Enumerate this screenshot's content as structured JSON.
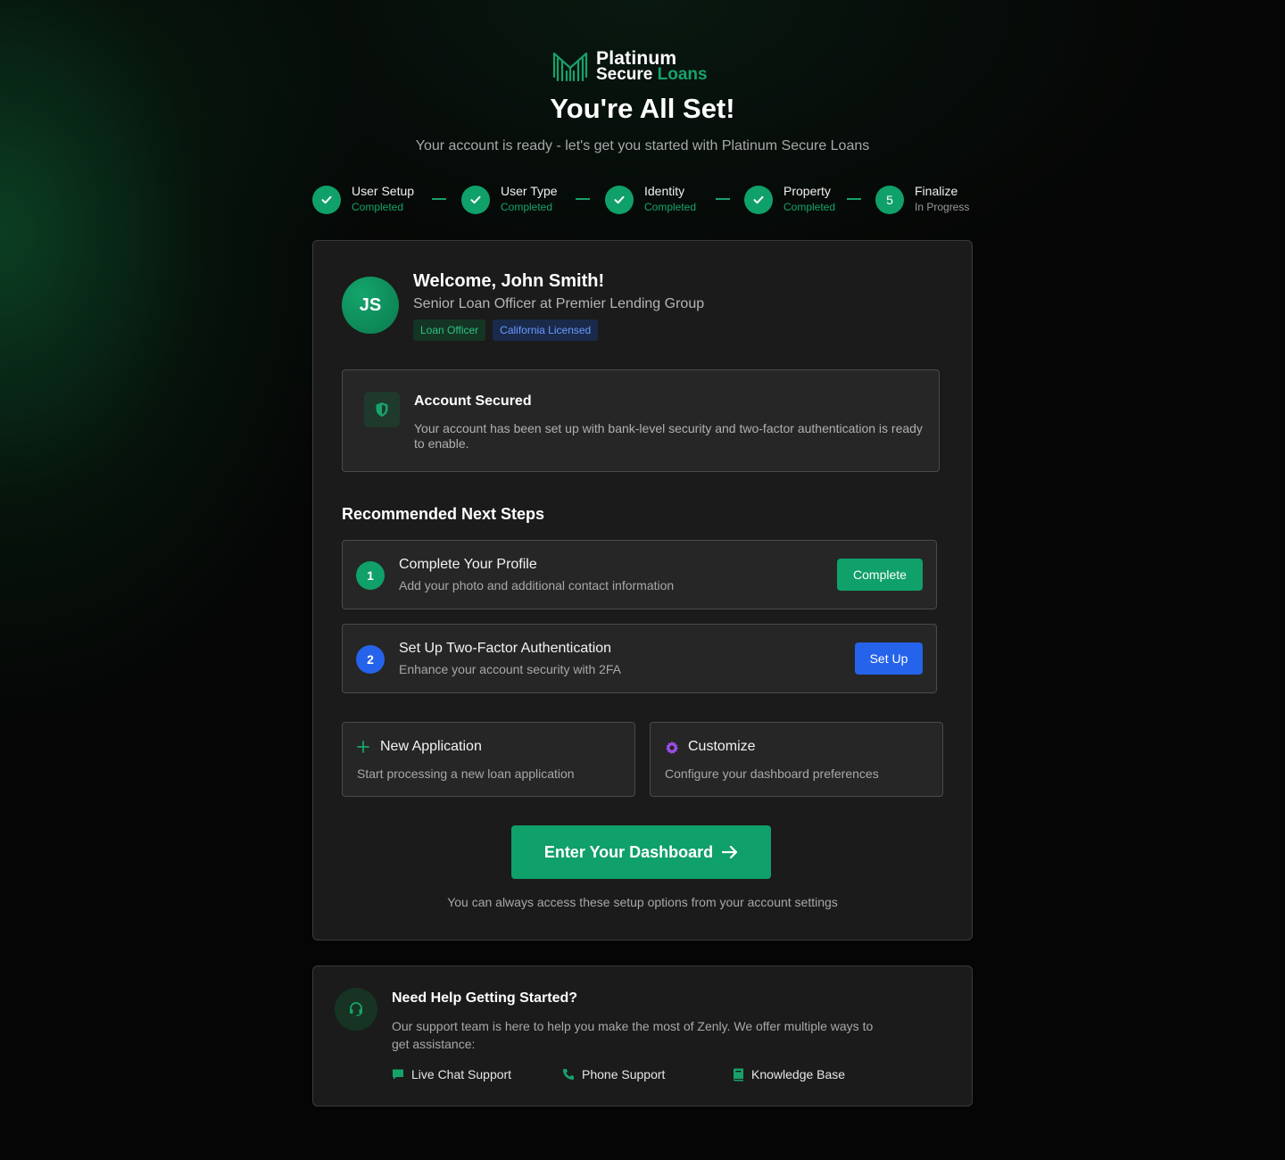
{
  "brand": {
    "line1": "Platinum",
    "line2a": "Secure",
    "line2b": "Loans",
    "accent_color": "#16a36a"
  },
  "header": {
    "title": "You're All Set!",
    "subtitle": "Your account is ready - let's get you started with Platinum Secure Loans"
  },
  "steps": [
    {
      "name": "User Setup",
      "status": "Completed",
      "icon": "check-icon"
    },
    {
      "name": "User Type",
      "status": "Completed",
      "icon": "check-icon"
    },
    {
      "name": "Identity",
      "status": "Completed",
      "icon": "check-icon"
    },
    {
      "name": "Property",
      "status": "Completed",
      "icon": "check-icon"
    },
    {
      "name": "Finalize",
      "status": "In Progress",
      "number": "5"
    }
  ],
  "profile": {
    "initials": "JS",
    "welcome": "Welcome, John Smith!",
    "role": "Senior Loan Officer at Premier Lending Group",
    "badges": [
      "Loan Officer",
      "California Licensed"
    ]
  },
  "security": {
    "icon": "shield-icon",
    "title": "Account Secured",
    "description": "Your account has been set up with bank-level security and two-factor authentication is ready to enable."
  },
  "next_steps": {
    "title": "Recommended Next Steps",
    "items": [
      {
        "number": "1",
        "title": "Complete Your Profile",
        "description": "Add your photo and additional contact information",
        "button": "Complete",
        "color": "#10a06a"
      },
      {
        "number": "2",
        "title": "Set Up Two-Factor Authentication",
        "description": "Enhance your account security with 2FA",
        "button": "Set Up",
        "color": "#2563eb"
      }
    ]
  },
  "quick_actions": [
    {
      "icon": "plus-icon",
      "title": "New Application",
      "description": "Start processing a new loan application"
    },
    {
      "icon": "gear-icon",
      "title": "Customize",
      "description": "Configure your dashboard preferences"
    }
  ],
  "cta": {
    "label": "Enter Your Dashboard",
    "icon": "arrow-right-icon",
    "footnote": "You can always access these setup options from your account settings"
  },
  "help": {
    "icon": "headset-icon",
    "title": "Need Help Getting Started?",
    "description": "Our support team is here to help you make the most of Zenly. We offer multiple ways to get assistance:",
    "links": [
      {
        "icon": "chat-icon",
        "label": "Live Chat Support"
      },
      {
        "icon": "phone-icon",
        "label": "Phone Support"
      },
      {
        "icon": "book-icon",
        "label": "Knowledge Base"
      }
    ]
  }
}
